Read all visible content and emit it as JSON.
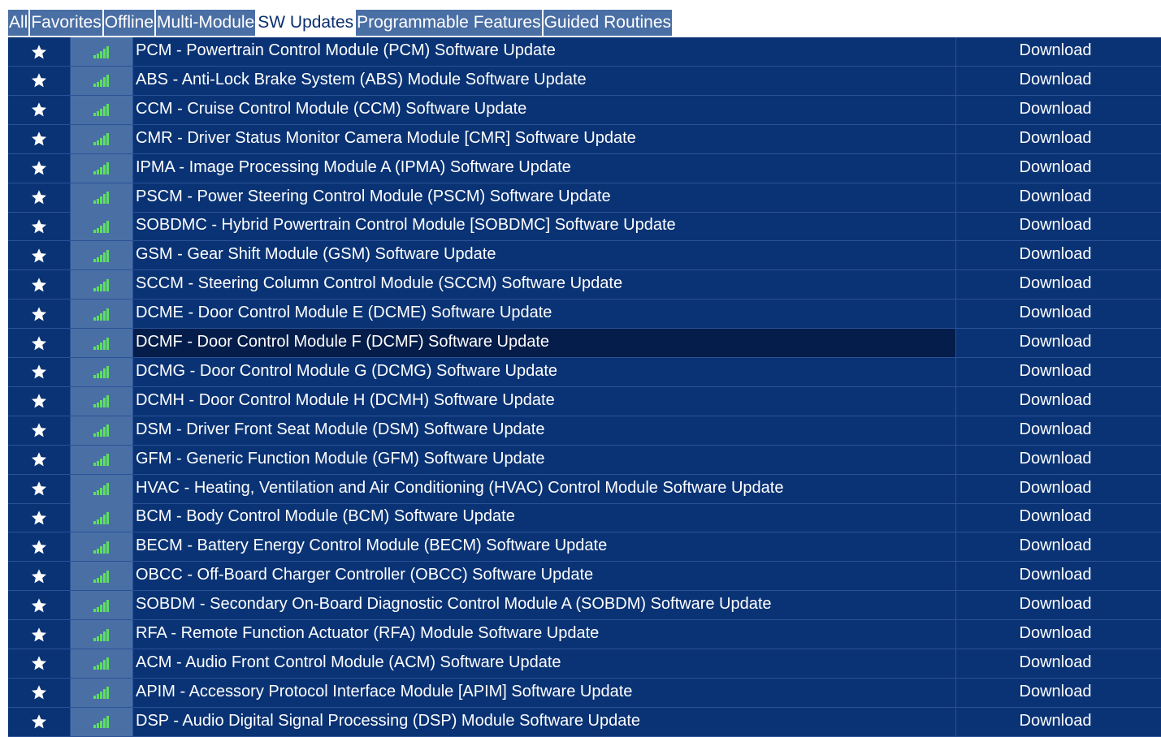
{
  "tabs": [
    {
      "label": "All",
      "active": false
    },
    {
      "label": "Favorites",
      "active": false
    },
    {
      "label": "Offline",
      "active": false
    },
    {
      "label": "Multi-Module",
      "active": false
    },
    {
      "label": "SW Updates",
      "active": true
    },
    {
      "label": "Programmable Features",
      "active": false
    },
    {
      "label": "Guided Routines",
      "active": false
    }
  ],
  "icons": {
    "favorite": "star-icon",
    "connectivity": "signal-bars-icon"
  },
  "colors": {
    "grid_background": "#0a3375",
    "highlight_row": "#041d4a",
    "signal_green": "#5ee05e",
    "tab_background": "#4a6fa5"
  },
  "rows": [
    {
      "name": "PCM - Powertrain Control Module (PCM) Software Update",
      "action": "Download"
    },
    {
      "name": "ABS - Anti-Lock Brake System (ABS) Module Software Update",
      "action": "Download"
    },
    {
      "name": "CCM - Cruise Control Module (CCM) Software Update",
      "action": "Download"
    },
    {
      "name": "CMR - Driver Status Monitor Camera Module [CMR] Software Update",
      "action": "Download"
    },
    {
      "name": "IPMA - Image Processing Module A (IPMA) Software Update",
      "action": "Download"
    },
    {
      "name": "PSCM - Power Steering Control Module (PSCM) Software Update",
      "action": "Download"
    },
    {
      "name": "SOBDMC - Hybrid Powertrain Control Module [SOBDMC] Software Update",
      "action": "Download"
    },
    {
      "name": "GSM - Gear Shift Module (GSM) Software Update",
      "action": "Download"
    },
    {
      "name": "SCCM - Steering Column Control Module (SCCM) Software Update",
      "action": "Download"
    },
    {
      "name": "DCME - Door Control Module E (DCME) Software Update",
      "action": "Download"
    },
    {
      "name": "DCMF - Door Control Module F (DCMF) Software Update",
      "action": "Download",
      "highlighted": true
    },
    {
      "name": "DCMG - Door Control Module G (DCMG) Software Update",
      "action": "Download"
    },
    {
      "name": "DCMH - Door Control Module H (DCMH) Software Update",
      "action": "Download"
    },
    {
      "name": "DSM - Driver Front Seat Module (DSM) Software Update",
      "action": "Download"
    },
    {
      "name": "GFM - Generic Function Module (GFM) Software Update",
      "action": "Download"
    },
    {
      "name": "HVAC - Heating, Ventilation and Air Conditioning (HVAC) Control Module Software Update",
      "action": "Download"
    },
    {
      "name": "BCM - Body Control Module (BCM) Software Update",
      "action": "Download"
    },
    {
      "name": "BECM - Battery Energy Control Module (BECM) Software Update",
      "action": "Download"
    },
    {
      "name": "OBCC - Off-Board Charger Controller (OBCC) Software Update",
      "action": "Download"
    },
    {
      "name": "SOBDM - Secondary On-Board Diagnostic Control Module A (SOBDM) Software Update",
      "action": "Download"
    },
    {
      "name": "RFA - Remote Function Actuator (RFA) Module Software Update",
      "action": "Download"
    },
    {
      "name": "ACM - Audio Front Control Module (ACM) Software Update",
      "action": "Download"
    },
    {
      "name": "APIM - Accessory Protocol Interface Module [APIM] Software Update",
      "action": "Download"
    },
    {
      "name": "DSP - Audio Digital Signal Processing (DSP) Module Software Update",
      "action": "Download"
    }
  ]
}
